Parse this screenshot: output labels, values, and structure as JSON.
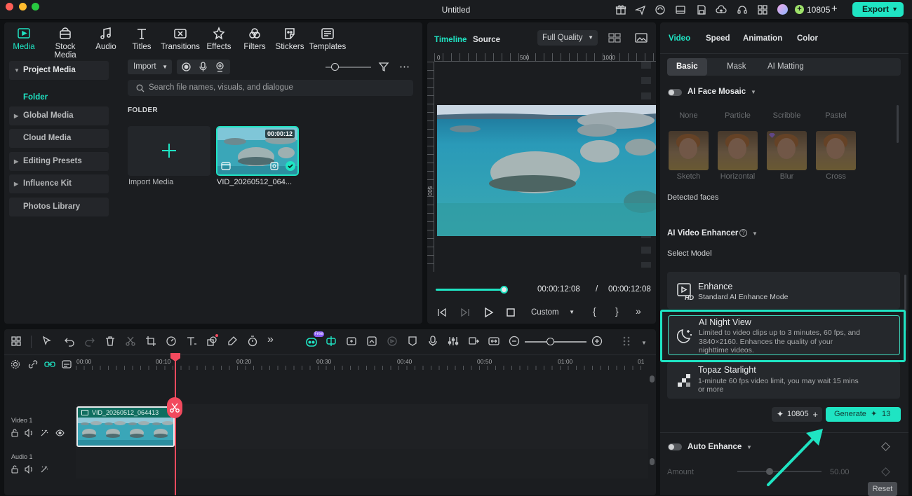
{
  "window": {
    "title": "Untitled",
    "credits": "10805",
    "export_label": "Export"
  },
  "media_tabs": [
    {
      "label": "Media",
      "icon": "media-icon"
    },
    {
      "label": "Stock Media",
      "icon": "stock-media-icon"
    },
    {
      "label": "Audio",
      "icon": "audio-icon"
    },
    {
      "label": "Titles",
      "icon": "titles-icon"
    },
    {
      "label": "Transitions",
      "icon": "transitions-icon"
    },
    {
      "label": "Effects",
      "icon": "effects-icon"
    },
    {
      "label": "Filters",
      "icon": "filters-icon"
    },
    {
      "label": "Stickers",
      "icon": "stickers-icon"
    },
    {
      "label": "Templates",
      "icon": "templates-icon"
    }
  ],
  "sidebar": {
    "items": [
      "Project Media",
      "Folder",
      "Global Media",
      "Cloud Media",
      "Editing Presets",
      "Influence Kit",
      "Photos Library"
    ]
  },
  "media": {
    "import_label": "Import",
    "search_placeholder": "Search file names, visuals, and dialogue",
    "folder_heading": "FOLDER",
    "import_tile_label": "Import Media",
    "clip_name": "VID_20260512_064...",
    "clip_duration": "00:00:12"
  },
  "preview": {
    "tab_timeline": "Timeline",
    "tab_source": "Source",
    "quality": "Full Quality",
    "ruler_top": [
      "0",
      "500",
      "1000"
    ],
    "ruler_side": "500",
    "current_time": "00:00:12:08",
    "separator": "/",
    "total_time": "00:00:12:08",
    "progress": 1.0,
    "zoom_label": "Custom"
  },
  "props": {
    "tabs": [
      "Video",
      "Speed",
      "Animation",
      "Color"
    ],
    "subtabs": [
      "Basic",
      "Mask",
      "AI Matting"
    ],
    "face_mosaic": {
      "title": "AI Face Mosaic",
      "options_top": [
        "None",
        "Particle",
        "Scribble",
        "Pastel"
      ],
      "options": [
        "Sketch",
        "Horizontal",
        "Blur",
        "Cross"
      ],
      "detected": "Detected faces"
    },
    "enhancer": {
      "title": "AI Video Enhancer",
      "select_model": "Select Model",
      "models": [
        {
          "title": "Enhance",
          "desc": "Standard AI Enhance Mode",
          "icon": "hd-play-icon"
        },
        {
          "title": "AI Night View",
          "desc1": "Limited to video clips up to 3 minutes, 60 fps, and",
          "desc2": "3840×2160. Enhances the quality of your",
          "desc3": "nighttime videos.",
          "icon": "moon-stars-icon"
        },
        {
          "title": "Topaz Starlight",
          "desc1": "1-minute 60 fps video limit, you may wait 15 mins",
          "desc2": "or more",
          "icon": "checker-icon"
        }
      ],
      "credits": "10805",
      "generate_label": "Generate",
      "generate_cost": "13"
    },
    "auto_enhance": {
      "title": "Auto Enhance",
      "amount_label": "Amount",
      "amount_value": "50.00"
    },
    "reset_label": "Reset"
  },
  "timeline": {
    "ruler": [
      "00:00",
      "00:10",
      "00:20",
      "00:30",
      "00:40",
      "00:50",
      "01:00",
      "01"
    ],
    "video_track": "Video 1",
    "audio_track": "Audio 1",
    "clip_name": "VID_20260512_064413",
    "ai_badge": "Free"
  },
  "colors": {
    "accent": "#1fe4c3",
    "playhead": "#f24a5e"
  }
}
